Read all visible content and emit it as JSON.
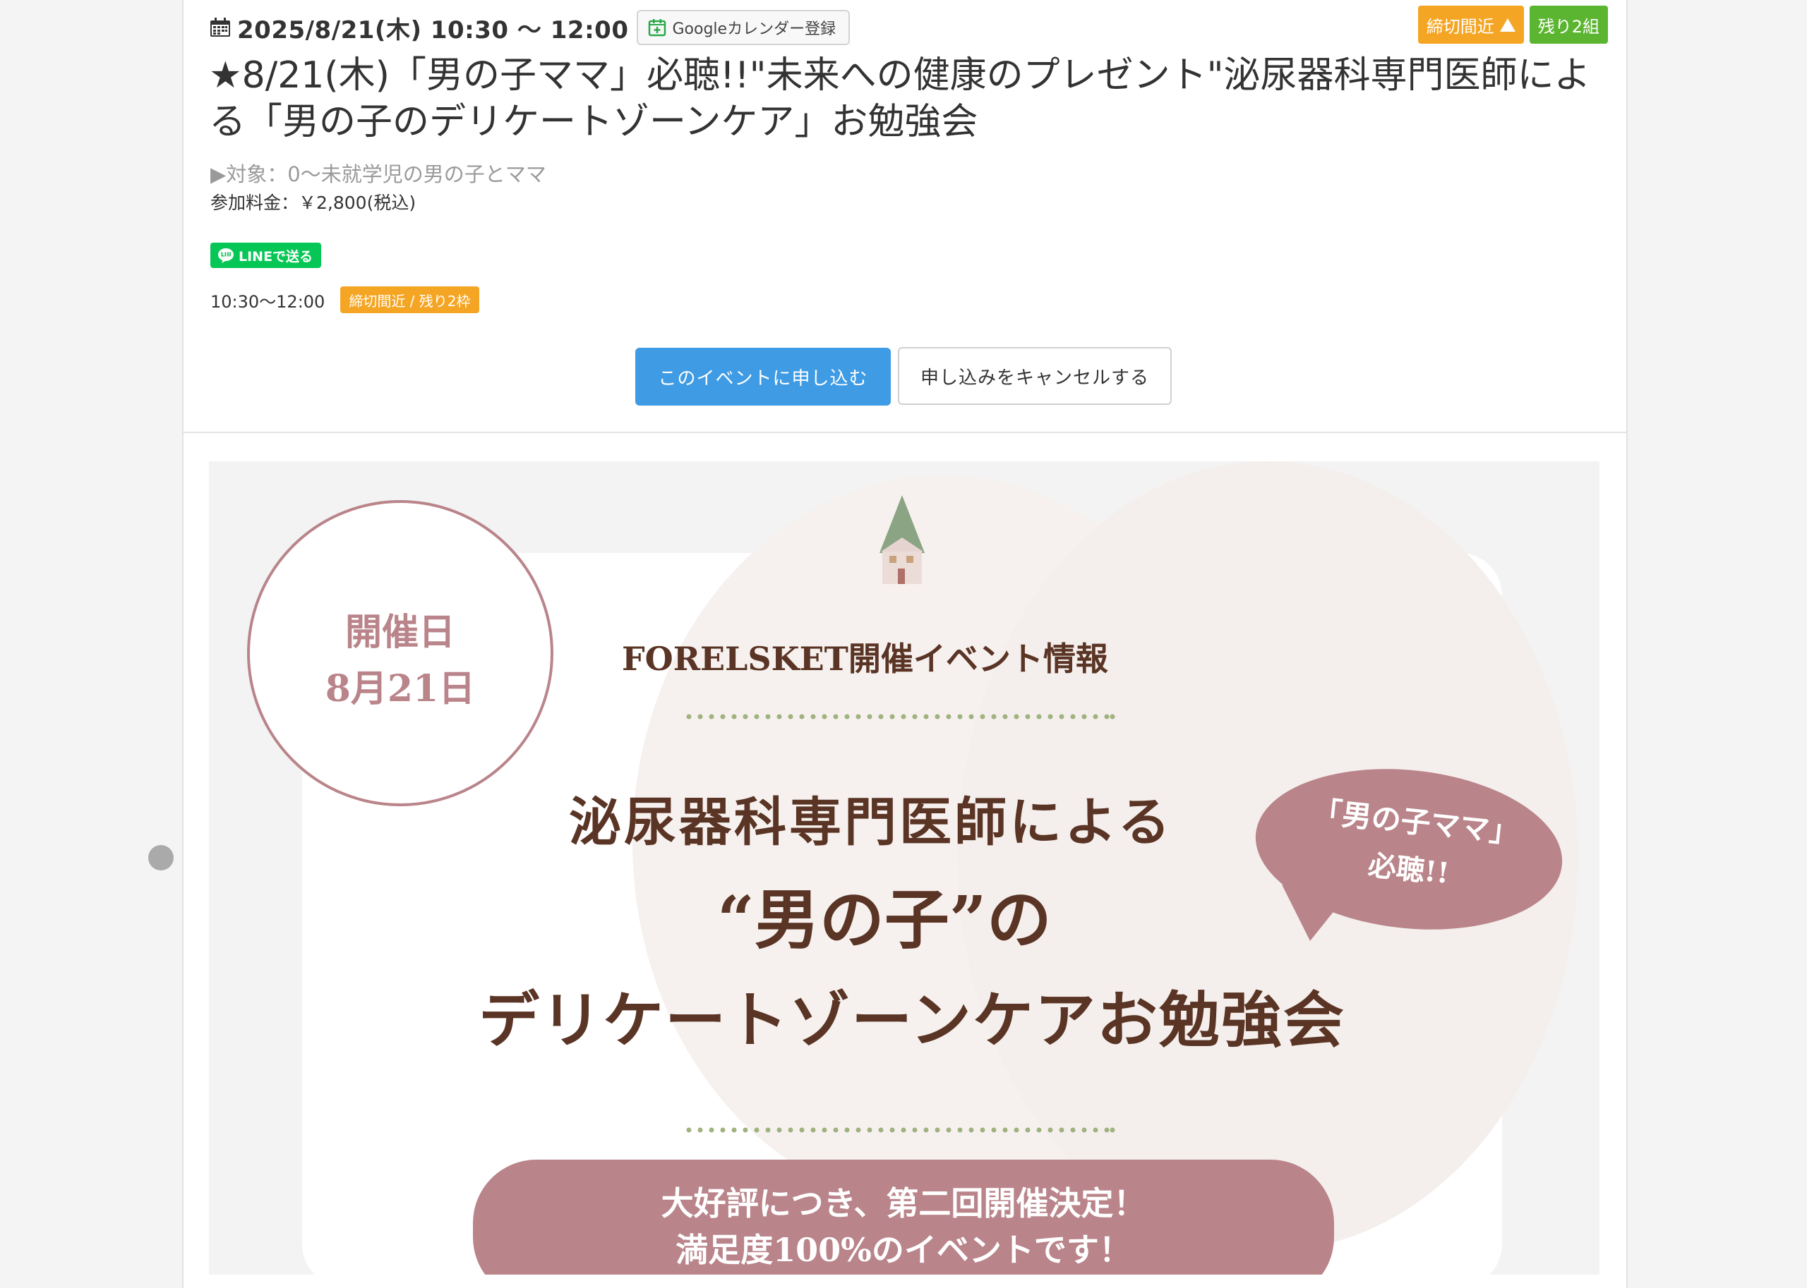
{
  "event": {
    "datetime": "2025/8/21(木) 10:30 〜 12:00",
    "gcal_label": "Googleカレンダー登録",
    "badge_deadline": "締切間近",
    "badge_remaining": "残り2組",
    "title": "★8/21(木)「男の子ママ」必聴!!\"未来への健康のプレゼント\"泌尿器科専門医師による「男の子のデリケートゾーンケア」お勉強会",
    "target": "▶対象：0〜未就学児の男の子とママ",
    "fee": "参加料金：￥2,800(税込)",
    "line_label": "LINEで送る",
    "slot_time": "10:30〜12:00",
    "slot_badge": "締切間近 / 残り2枠",
    "apply_label": "このイベントに申し込む",
    "cancel_label": "申し込みをキャンセルする"
  },
  "banner": {
    "date_label": "開催日",
    "date_value": "8月21日",
    "org_label": "FORELSKET開催イベント情報",
    "headline1": "泌尿器科専門医師による",
    "headline2": "“男の子”の",
    "headline3": "デリケートゾーンケアお勉強会",
    "bubble1": "「男の子ママ」",
    "bubble2": "必聴!!",
    "pill1": "大好評につき、第二回開催決定！",
    "pill2": "満足度100%のイベントです！"
  },
  "colors": {
    "orange": "#f5a524",
    "green": "#5bb530",
    "blue": "#3f9be3",
    "line_green": "#06c755",
    "banner_pink": "#b9848a",
    "banner_brown": "#5a3424"
  },
  "icons": [
    "calendar-icon",
    "google-calendar-add-icon",
    "warning-triangle-icon",
    "line-icon",
    "tree-icon",
    "house-icon"
  ]
}
